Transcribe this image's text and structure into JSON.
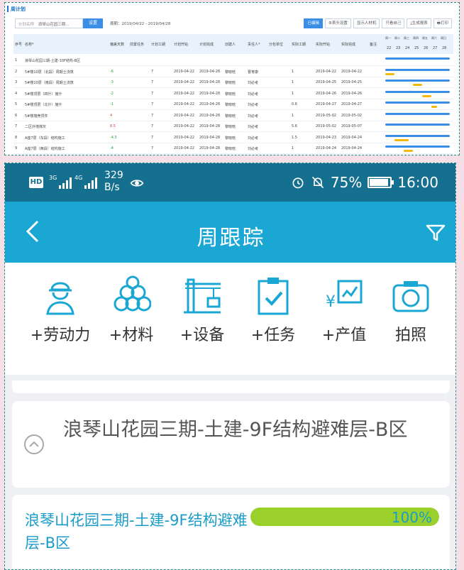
{
  "top_panel": {
    "title": "周计划",
    "filter": {
      "label": "计划名称",
      "value": "浪琴山花园三期..."
    },
    "set_button": "设置",
    "period": "周期：2019/04/22 - 2019/04/28",
    "buttons": [
      "已编辑",
      "⚙表头设置",
      "显示人材机",
      "只看自己",
      "⤓生成报表",
      "🖶打印"
    ],
    "columns": [
      "序号",
      "名称*",
      "偏差天数",
      "前置任务",
      "计划工期",
      "计划开始",
      "计划完成",
      "创建人",
      "责任人*",
      "分包单位",
      "实际工期",
      "实际开始",
      "实际完成",
      "备注"
    ],
    "gantt_days": [
      "22",
      "23",
      "24",
      "25",
      "26",
      "27",
      "28"
    ],
    "gantt_weekdays": [
      "周一",
      "周二",
      "周三",
      "周四",
      "周五",
      "周六",
      "周日"
    ],
    "rows": [
      {
        "no": "1",
        "name": "浪琴山花园三期-土建-10F结构-B区",
        "dev": "",
        "pre": "",
        "dur": "",
        "ps": "",
        "pe": "",
        "creator": "",
        "owner": "",
        "sub": "",
        "adur": "",
        "as": "",
        "ae": ""
      },
      {
        "no": "2",
        "name": "5#楼10层（北段）周期土浇筑",
        "dev": "-6",
        "pre": "",
        "dur": "7",
        "ps": "2019-04-22",
        "pe": "2019-04-28",
        "creator": "黎晓晗",
        "owner": "曹育康",
        "sub": "",
        "adur": "1",
        "as": "2019-04-22",
        "ae": "2019-04-22"
      },
      {
        "no": "3",
        "name": "5#楼10层（南段）周期土浇筑",
        "dev": "-3",
        "pre": "",
        "dur": "7",
        "ps": "2019-04-22",
        "pe": "2019-04-28",
        "creator": "黎晓晗",
        "owner": "刘必考",
        "sub": "",
        "adur": "1",
        "as": "2019-04-25",
        "ae": "2019-04-25"
      },
      {
        "no": "4",
        "name": "5#楼顶层（四什）施什",
        "dev": "-2",
        "pre": "",
        "dur": "7",
        "ps": "2019-04-22",
        "pe": "2019-04-28",
        "creator": "黎晓晗",
        "owner": "刘必考",
        "sub": "",
        "adur": "1",
        "as": "2019-04-26",
        "ae": "2019-04-26"
      },
      {
        "no": "5",
        "name": "5#楼顶层（北什）施什",
        "dev": "-1",
        "pre": "",
        "dur": "7",
        "ps": "2019-04-22",
        "pe": "2019-04-28",
        "creator": "黎晓晗",
        "owner": "刘必考",
        "sub": "",
        "adur": "0.6",
        "as": "2019-04-27",
        "ae": "2019-04-27"
      },
      {
        "no": "6",
        "name": "5#楼墙壳顶件",
        "dev": "4",
        "pre": "",
        "dur": "7",
        "ps": "2019-04-22",
        "pe": "2019-04-28",
        "creator": "黎晓晗",
        "owner": "刘必考",
        "sub": "",
        "adur": "1",
        "as": "2019-05-02",
        "ae": "2019-05-02"
      },
      {
        "no": "7",
        "name": "二区外墙抹灰",
        "dev": "8.5",
        "pre": "",
        "dur": "7",
        "ps": "2019-04-22",
        "pe": "2019-04-28",
        "creator": "黎晓晗",
        "owner": "刘必考",
        "sub": "",
        "adur": "5.6",
        "as": "2019-05-02",
        "ae": "2019-05-07"
      },
      {
        "no": "8",
        "name": "A座7层（东段）结构施工",
        "dev": "-4.5",
        "pre": "",
        "dur": "7",
        "ps": "2019-04-22",
        "pe": "2019-04-28",
        "creator": "黎晓晗",
        "owner": "刘必考",
        "sub": "",
        "adur": "1.5",
        "as": "2019-04-23",
        "ae": "2019-04-24"
      },
      {
        "no": "9",
        "name": "A座7层（西段）结构施工",
        "dev": "-4",
        "pre": "",
        "dur": "7",
        "ps": "2019-04-22",
        "pe": "2019-04-28",
        "creator": "黎晓晗",
        "owner": "刘必考",
        "sub": "",
        "adur": "1",
        "as": "2019-04-24",
        "ae": "2019-04-24"
      }
    ],
    "gantt": [
      {
        "plan": [
          0,
          7
        ],
        "actual": null
      },
      {
        "plan": [
          0,
          7
        ],
        "actual": [
          0,
          1
        ]
      },
      {
        "plan": [
          0,
          7
        ],
        "actual": [
          3,
          1
        ]
      },
      {
        "plan": [
          0,
          7
        ],
        "actual": [
          4,
          1
        ]
      },
      {
        "plan": [
          0,
          7
        ],
        "actual": [
          5,
          0.6
        ]
      },
      {
        "plan": [
          0,
          7
        ],
        "actual": null
      },
      {
        "plan": [
          0,
          7
        ],
        "actual": null
      },
      {
        "plan": [
          0,
          7
        ],
        "actual": [
          1,
          1.5
        ]
      },
      {
        "plan": [
          0,
          7
        ],
        "actual": [
          2,
          1
        ]
      }
    ]
  },
  "status_bar": {
    "hd": "HD",
    "sig1": "3G",
    "sig2": "4G",
    "speed_value": "329",
    "speed_unit": "B/s",
    "battery": "75%",
    "time": "16:00"
  },
  "nav": {
    "title": "周跟踪"
  },
  "quick_actions": [
    {
      "label": "+劳动力",
      "icon": "worker-icon"
    },
    {
      "label": "+材料",
      "icon": "materials-icon"
    },
    {
      "label": "+设备",
      "icon": "crane-icon"
    },
    {
      "label": "+任务",
      "icon": "task-clipboard-icon"
    },
    {
      "label": "+产值",
      "icon": "output-value-icon"
    },
    {
      "label": "拍照",
      "icon": "camera-icon"
    }
  ],
  "group": {
    "title": "浪琴山花园三期-土建-9F结构避难层-B区"
  },
  "task": {
    "name": "浪琴山花园三期-土建-9F结构避难层-B区",
    "progress": 100,
    "progress_label": "100%"
  },
  "colors": {
    "nav": "#1ba7d4",
    "status": "#156f8e",
    "accent_text": "#1b9bc8",
    "progress": "#9bd02a",
    "gantt_plan": "#3a8ee6",
    "gantt_actual": "#f2b90c"
  }
}
